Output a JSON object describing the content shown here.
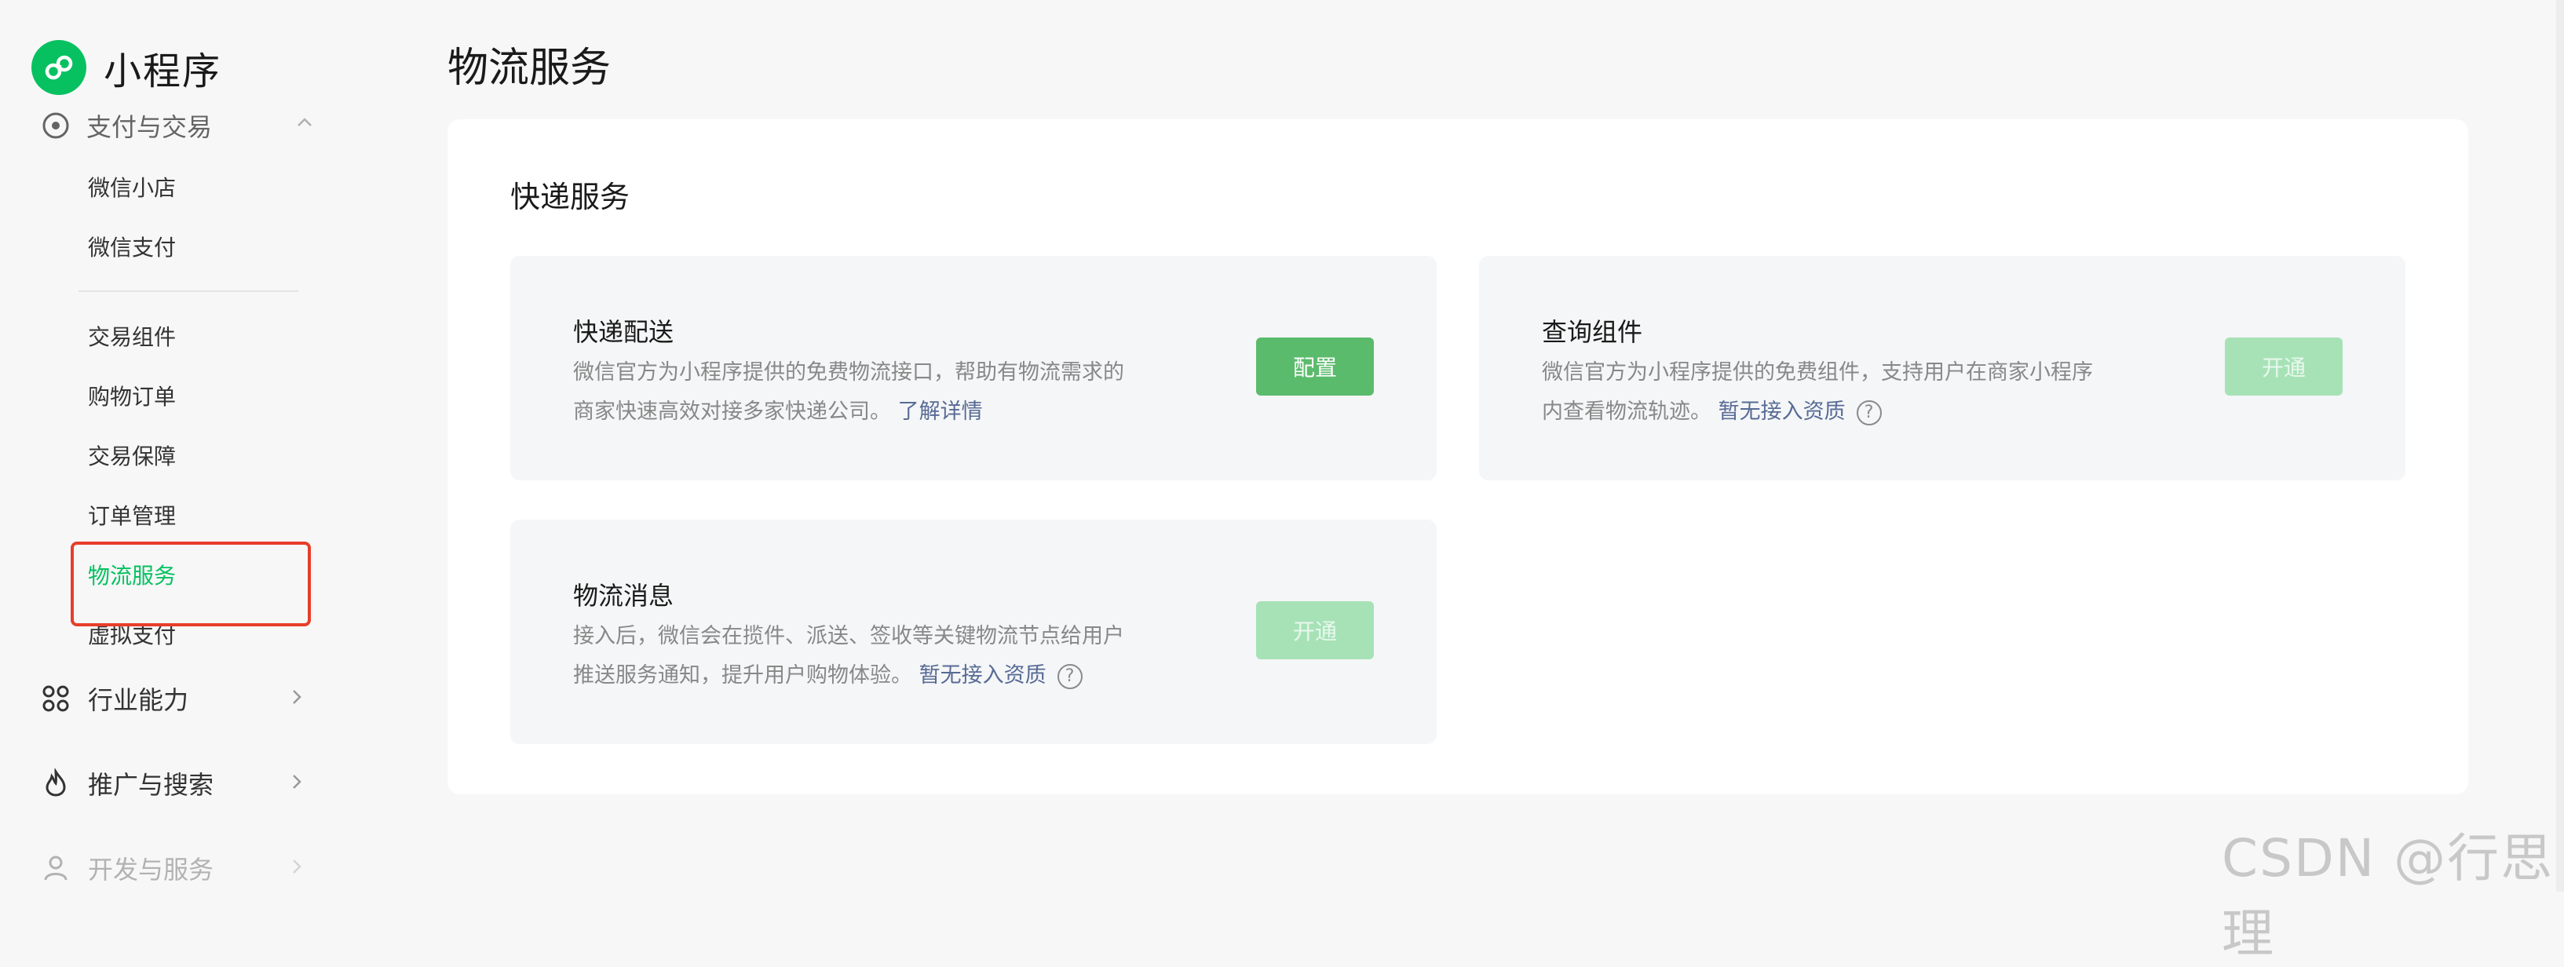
{
  "brand": {
    "title": "小程序"
  },
  "sidebar": {
    "group_cut": {
      "label": "支付与交易"
    },
    "sub_items_a": [
      {
        "label": "微信小店"
      },
      {
        "label": "微信支付"
      }
    ],
    "sub_items_b": [
      {
        "label": "交易组件"
      },
      {
        "label": "购物订单"
      },
      {
        "label": "交易保障"
      },
      {
        "label": "订单管理"
      },
      {
        "label": "物流服务",
        "active": true
      },
      {
        "label": "虚拟支付"
      }
    ],
    "groups": [
      {
        "label": "行业能力",
        "icon": "industry-icon"
      },
      {
        "label": "推广与搜索",
        "icon": "flame-icon"
      },
      {
        "label": "开发与服务",
        "icon": "users-icon"
      }
    ]
  },
  "main": {
    "page_title": "物流服务",
    "section_title": "快递服务",
    "cards": [
      {
        "title": "快递配送",
        "desc_line1": "微信官方为小程序提供的免费物流接口，帮助有物流需求的",
        "desc_line2": "商家快速高效对接多家快递公司。",
        "link": "了解详情",
        "button": "配置",
        "button_enabled": true
      },
      {
        "title": "查询组件",
        "desc_line1": "微信官方为小程序提供的免费组件，支持用户在商家小程序",
        "desc_line2": "内查看物流轨迹。",
        "link": "暂无接入资质",
        "help": "?",
        "button": "开通",
        "button_enabled": false
      },
      {
        "title": "物流消息",
        "desc_line1": "接入后，微信会在揽件、派送、签收等关键物流节点给用户",
        "desc_line2": "推送服务通知，提升用户购物体验。",
        "link": "暂无接入资质",
        "help": "?",
        "button": "开通",
        "button_enabled": false
      }
    ]
  },
  "watermark": "CSDN @行思理",
  "colors": {
    "accent": "#07c160",
    "button": "#5bbb6d",
    "button_disabled": "#a7e2b7",
    "link": "#576b95",
    "highlight": "#e83e2a"
  }
}
